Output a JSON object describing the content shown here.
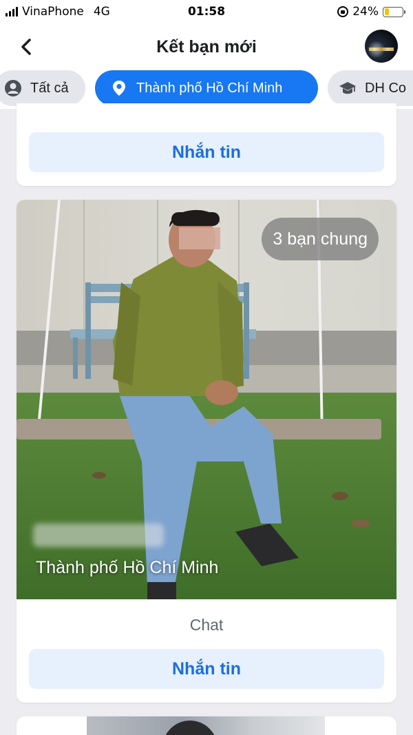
{
  "status_bar": {
    "carrier": "VinaPhone",
    "network": "4G",
    "time": "01:58",
    "battery": "24%",
    "battery_level": 0.24,
    "battery_color": "#f5c400"
  },
  "header": {
    "title": "Kết bạn mới",
    "back_icon": "chevron-left-icon"
  },
  "filters": {
    "accent_color": "#1877f2",
    "items": [
      {
        "label": "Tất cả",
        "icon": "person-circle-icon",
        "active": false
      },
      {
        "label": "Thành phố Hồ Chí Minh",
        "icon": "location-pin-icon",
        "active": true
      },
      {
        "label": "DH Co",
        "icon": "graduation-cap-icon",
        "active": false
      }
    ]
  },
  "cards": [
    {
      "button_label": "Nhắn tin"
    },
    {
      "mutual_friends": "3 bạn chung",
      "location": "Thành phố Hồ Chí Minh",
      "chat_label": "Chat",
      "button_label": "Nhắn tin"
    }
  ]
}
